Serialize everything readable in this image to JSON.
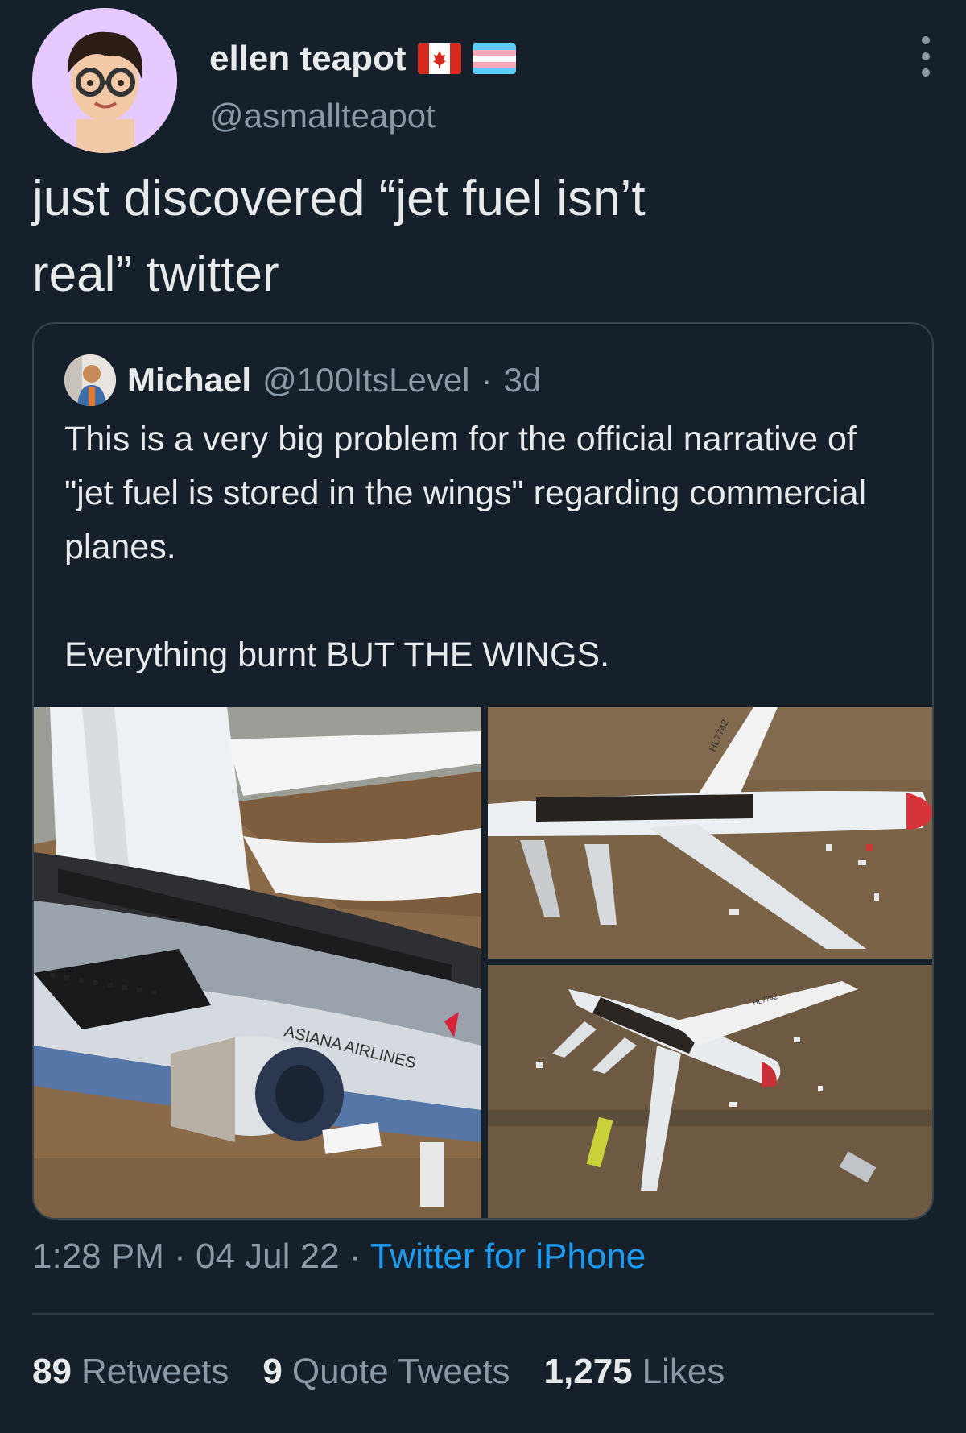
{
  "author": {
    "display_name": "ellen teapot",
    "handle": "@asmallteapot",
    "avatar_icon": "memoji-avatar-icon",
    "badges": [
      "canada-flag-icon",
      "trans-flag-icon"
    ]
  },
  "tweet": {
    "line1": "just discovered “jet fuel isn’t",
    "line2": "real” twitter"
  },
  "quoted": {
    "name": "Michael",
    "handle": "@100ItsLevel",
    "separator": "·",
    "age": "3d",
    "paragraph1": "This is a very big problem for the official narrative of \"jet fuel is stored in the wings\" regarding commercial planes.",
    "paragraph2": "Everything burnt BUT THE WINGS.",
    "images": {
      "main_fuselage_label": "ASIANA AIRLINES",
      "tail_registration": "HL7742"
    }
  },
  "meta": {
    "time": "1:28 PM",
    "sep1": "·",
    "date": "04 Jul 22",
    "sep2": "·",
    "source": "Twitter for iPhone"
  },
  "stats": {
    "retweets_count": "89",
    "retweets_label": "Retweets",
    "quotes_count": "9",
    "quotes_label": "Quote Tweets",
    "likes_count": "1,275",
    "likes_label": "Likes"
  },
  "colors": {
    "background": "#15202b",
    "text": "#e7e9ea",
    "secondary": "#8b98a5",
    "link": "#1d9bf0",
    "border": "#38444d"
  }
}
